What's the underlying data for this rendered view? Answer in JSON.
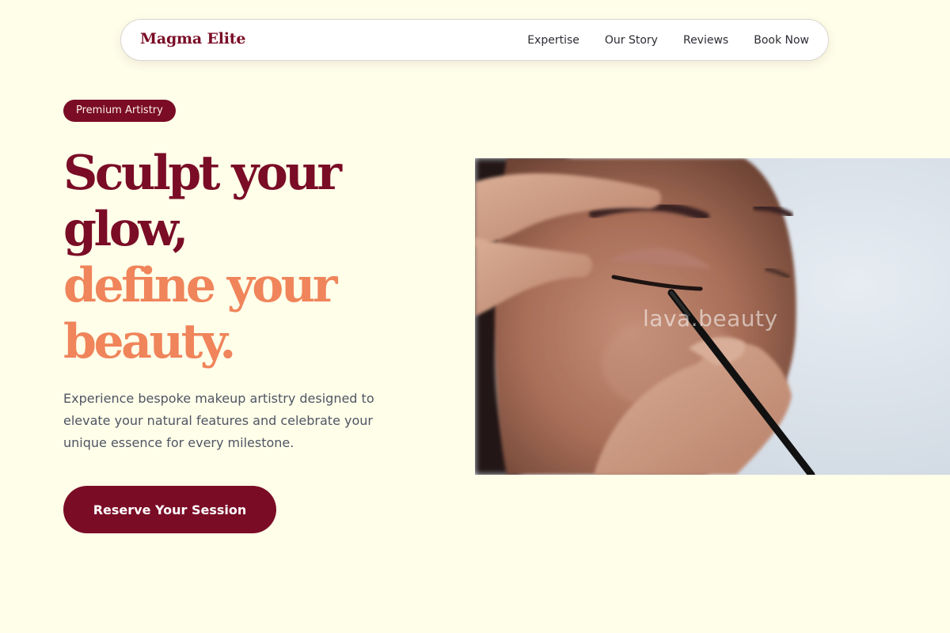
{
  "nav": {
    "brand": "Magma Elite",
    "links": [
      "Expertise",
      "Our Story",
      "Reviews",
      "Book Now"
    ]
  },
  "hero": {
    "badge": "Premium Artistry",
    "headline": {
      "line1": "Sculpt your",
      "line2": "glow,",
      "line3": "define your",
      "line4": "beauty."
    },
    "description": "Experience bespoke makeup artistry designed to elevate your natural features and celebrate your unique essence for every milestone.",
    "cta_label": "Reserve Your Session"
  },
  "image": {
    "watermark": "lava.beauty",
    "subject": "makeup-artist-applying-eyeliner-photo"
  },
  "colors": {
    "background": "#fefee9",
    "brand": "#7a0c26",
    "accent": "#f0845a",
    "body_text": "#4f5563"
  }
}
